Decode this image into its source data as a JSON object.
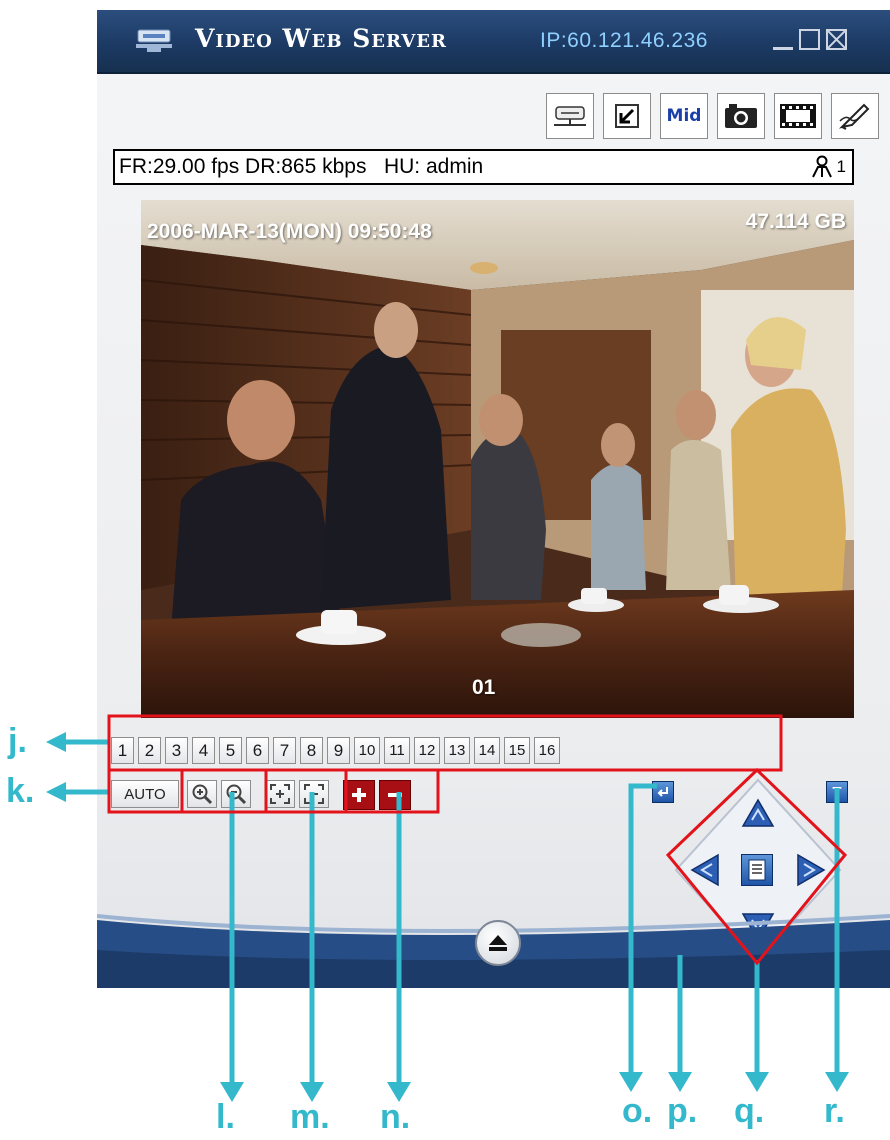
{
  "window": {
    "title": "Video Web Server",
    "ip": "IP:60.121.46.236"
  },
  "toolbar": {
    "buttons": [
      {
        "icon": "server-icon"
      },
      {
        "icon": "resize-arrow-icon"
      },
      {
        "label": "Mid",
        "icon": "quality-mid-icon"
      },
      {
        "icon": "camera-snapshot-icon"
      },
      {
        "icon": "film-record-icon"
      },
      {
        "icon": "settings-pen-icon"
      }
    ]
  },
  "status": {
    "text": "FR:29.00 fps DR:865 kbps   HU: admin",
    "user_count": "1"
  },
  "video": {
    "timestamp": "2006-MAR-13(MON) 09:50:48",
    "disk_free": "47.114 GB",
    "channel": "01"
  },
  "channels": [
    "1",
    "2",
    "3",
    "4",
    "5",
    "6",
    "7",
    "8",
    "9",
    "10",
    "11",
    "12",
    "13",
    "14",
    "15",
    "16"
  ],
  "controls": {
    "auto_label": "AUTO"
  },
  "ptz": {
    "p_label": "P",
    "t_label": "T"
  },
  "annotations": {
    "j": "j.",
    "k": "k.",
    "l": "l.",
    "m": "m.",
    "n": "n.",
    "o": "o.",
    "p": "p.",
    "q": "q.",
    "r": "r."
  },
  "colors": {
    "title_bar": "#1c3a64",
    "annotation": "#34b8cc",
    "highlight_box": "#e3131b",
    "red_button": "#a80f14"
  }
}
